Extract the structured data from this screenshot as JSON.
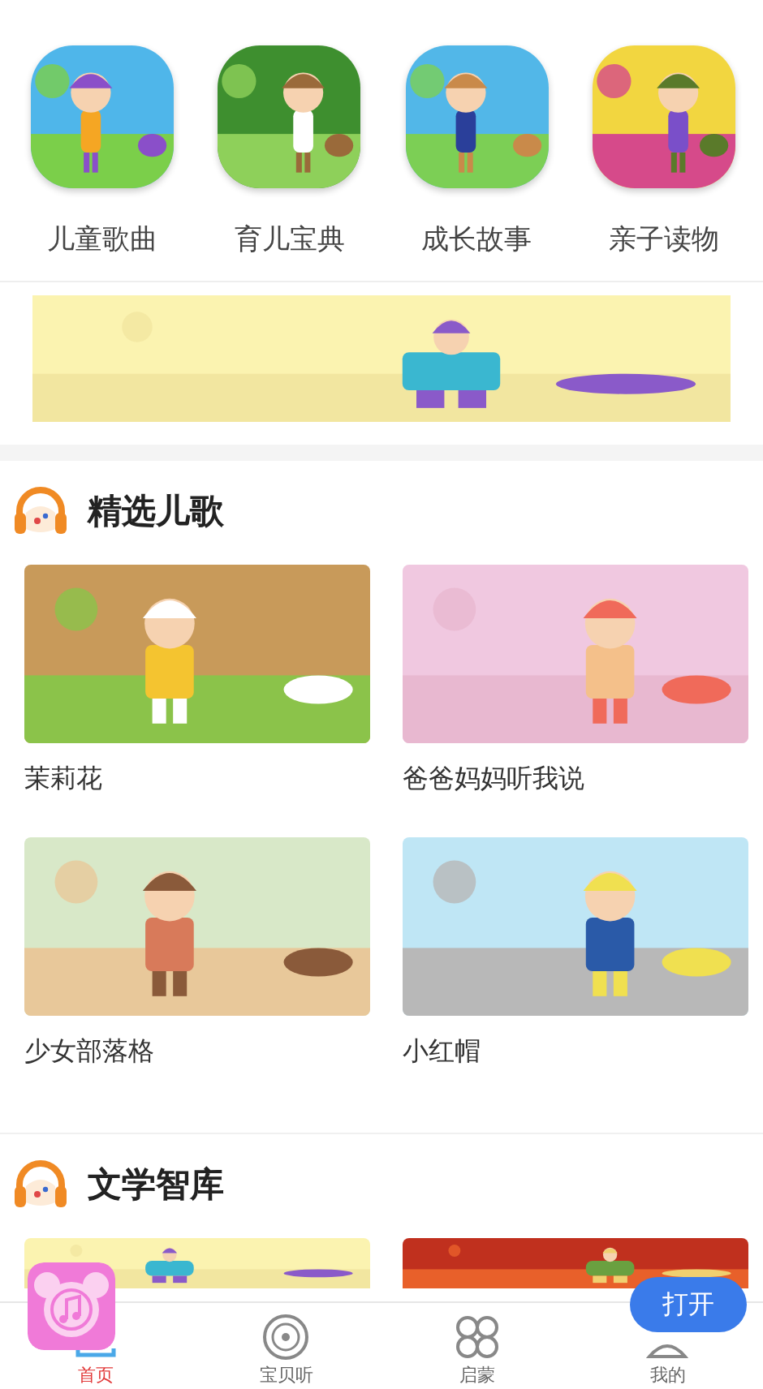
{
  "categories": [
    {
      "label": "儿童歌曲"
    },
    {
      "label": "育儿宝典"
    },
    {
      "label": "成长故事"
    },
    {
      "label": "亲子读物"
    }
  ],
  "sections": [
    {
      "title": "精选儿歌",
      "items": [
        {
          "kind": "video",
          "title": "茉莉花"
        },
        {
          "kind": "video",
          "title": "爸爸妈妈听我说"
        },
        {
          "kind": "video",
          "title": "少女部落格"
        },
        {
          "kind": "video",
          "title": "小红帽"
        }
      ]
    },
    {
      "title": "文学智库"
    }
  ],
  "floating_app": {
    "button": "打开"
  },
  "tab_bar": [
    {
      "label": "首页",
      "selected": true
    },
    {
      "label": "宝贝听",
      "selected": false
    },
    {
      "label": "启蒙",
      "selected": false
    },
    {
      "label": "我的",
      "selected": false
    }
  ]
}
